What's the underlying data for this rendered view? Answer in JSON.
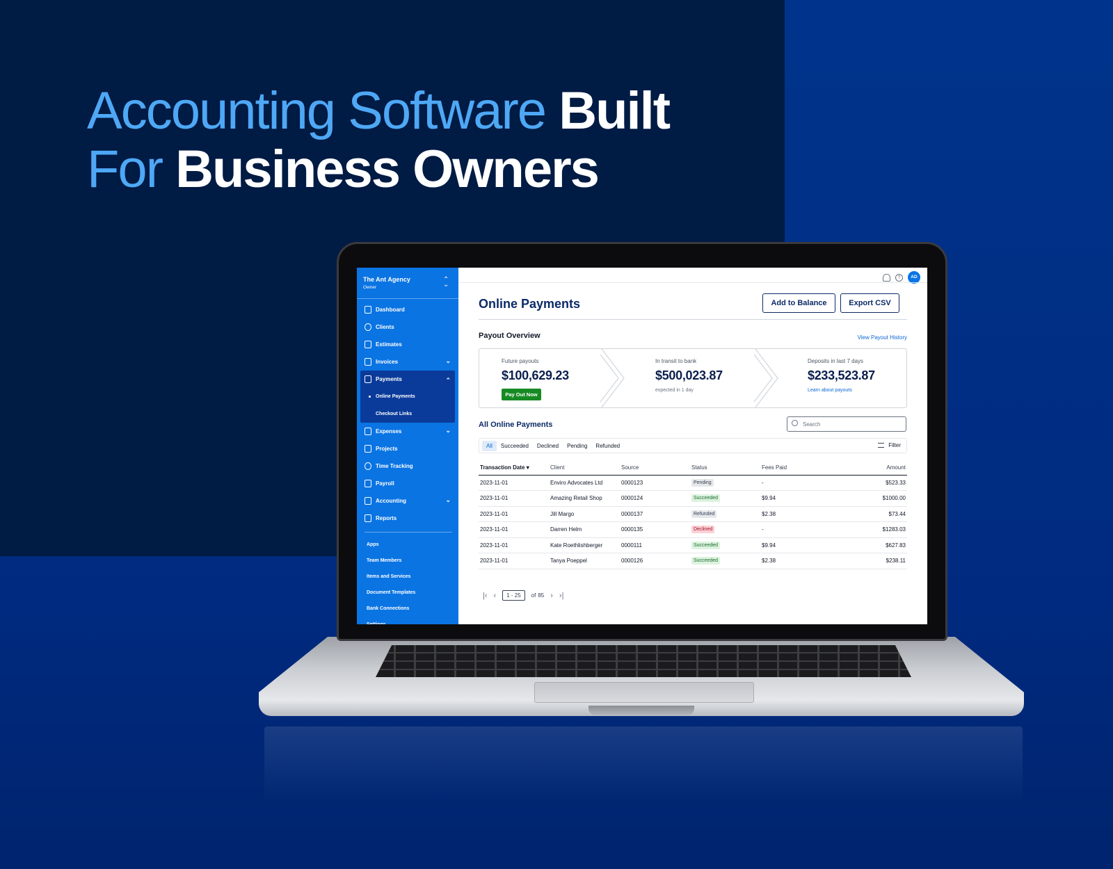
{
  "hero": {
    "line1_light": "Accounting Software",
    "line1_bold": "Built",
    "line2_light": "For",
    "line2_bold": "Business Owners"
  },
  "sidebar": {
    "org_name": "The Ant Agency",
    "org_role": "Owner",
    "items": [
      {
        "label": "Dashboard",
        "icon": "chart-icon"
      },
      {
        "label": "Clients",
        "icon": "users-icon"
      },
      {
        "label": "Estimates",
        "icon": "calculator-icon"
      },
      {
        "label": "Invoices",
        "icon": "invoice-icon"
      },
      {
        "label": "Payments",
        "icon": "wallet-icon"
      },
      {
        "label": "Online Payments"
      },
      {
        "label": "Checkout Links"
      },
      {
        "label": "Expenses",
        "icon": "receipt-icon"
      },
      {
        "label": "Projects",
        "icon": "folder-icon"
      },
      {
        "label": "Time Tracking",
        "icon": "clock-icon"
      },
      {
        "label": "Payroll",
        "icon": "calculator-icon"
      },
      {
        "label": "Accounting",
        "icon": "ledger-icon"
      },
      {
        "label": "Reports",
        "icon": "report-icon"
      }
    ],
    "links": [
      "Apps",
      "Team Members",
      "Items and Services",
      "Document Templates",
      "Bank Connections",
      "Settings"
    ]
  },
  "topbar": {
    "avatar_initials": "AD"
  },
  "main": {
    "title": "Online Payments",
    "add_to_balance": "Add to Balance",
    "export_csv": "Export CSV",
    "payout_overview": "Payout Overview",
    "view_payout_history": "View Payout History",
    "kpis": [
      {
        "label": "Future payouts",
        "value": "$100,629.23",
        "action": "Pay Out Now"
      },
      {
        "label": "In transit to bank",
        "value": "$500,023.87",
        "sub": "expected in 1 day"
      },
      {
        "label": "Deposits in last 7 days",
        "value": "$233,523.87",
        "link": "Learn about payouts"
      }
    ],
    "all_payments_title": "All Online Payments",
    "search_placeholder": "Search",
    "tabs": [
      "All",
      "Succeeded",
      "Declined",
      "Pending",
      "Refunded"
    ],
    "filter_label": "Filter",
    "table": {
      "headers": [
        "Transaction Date",
        "Client",
        "Source",
        "Status",
        "Fees Paid",
        "Amount"
      ],
      "rows": [
        [
          "2023-11-01",
          "Enviro Advocates Ltd",
          "0000123",
          "Pending",
          "-",
          "$523.33"
        ],
        [
          "2023-11-01",
          "Amazing Retail Shop",
          "0000124",
          "Succeeded",
          "$9.94",
          "$1000.00"
        ],
        [
          "2023-11-01",
          "Jill Margo",
          "0000137",
          "Refunded",
          "$2.38",
          "$73.44"
        ],
        [
          "2023-11-01",
          "Darren Helm",
          "0000135",
          "Declined",
          "-",
          "$1283.03"
        ],
        [
          "2023-11-01",
          "Kate Roethlishberger",
          "0000111",
          "Succeeded",
          "$9.94",
          "$627.83"
        ],
        [
          "2023-11-01",
          "Tanya Poeppel",
          "0000126",
          "Succeeded",
          "$2.38",
          "$238.11"
        ]
      ]
    },
    "pager": {
      "range": "1 - 25",
      "of": "of",
      "total": "85"
    }
  },
  "colors": {
    "sidebar": "#0a74e3",
    "sidebar_active": "#0b3b9a",
    "navy_text": "#0b2a66",
    "accent_light": "#4ea8f5",
    "success": "#168a23"
  }
}
